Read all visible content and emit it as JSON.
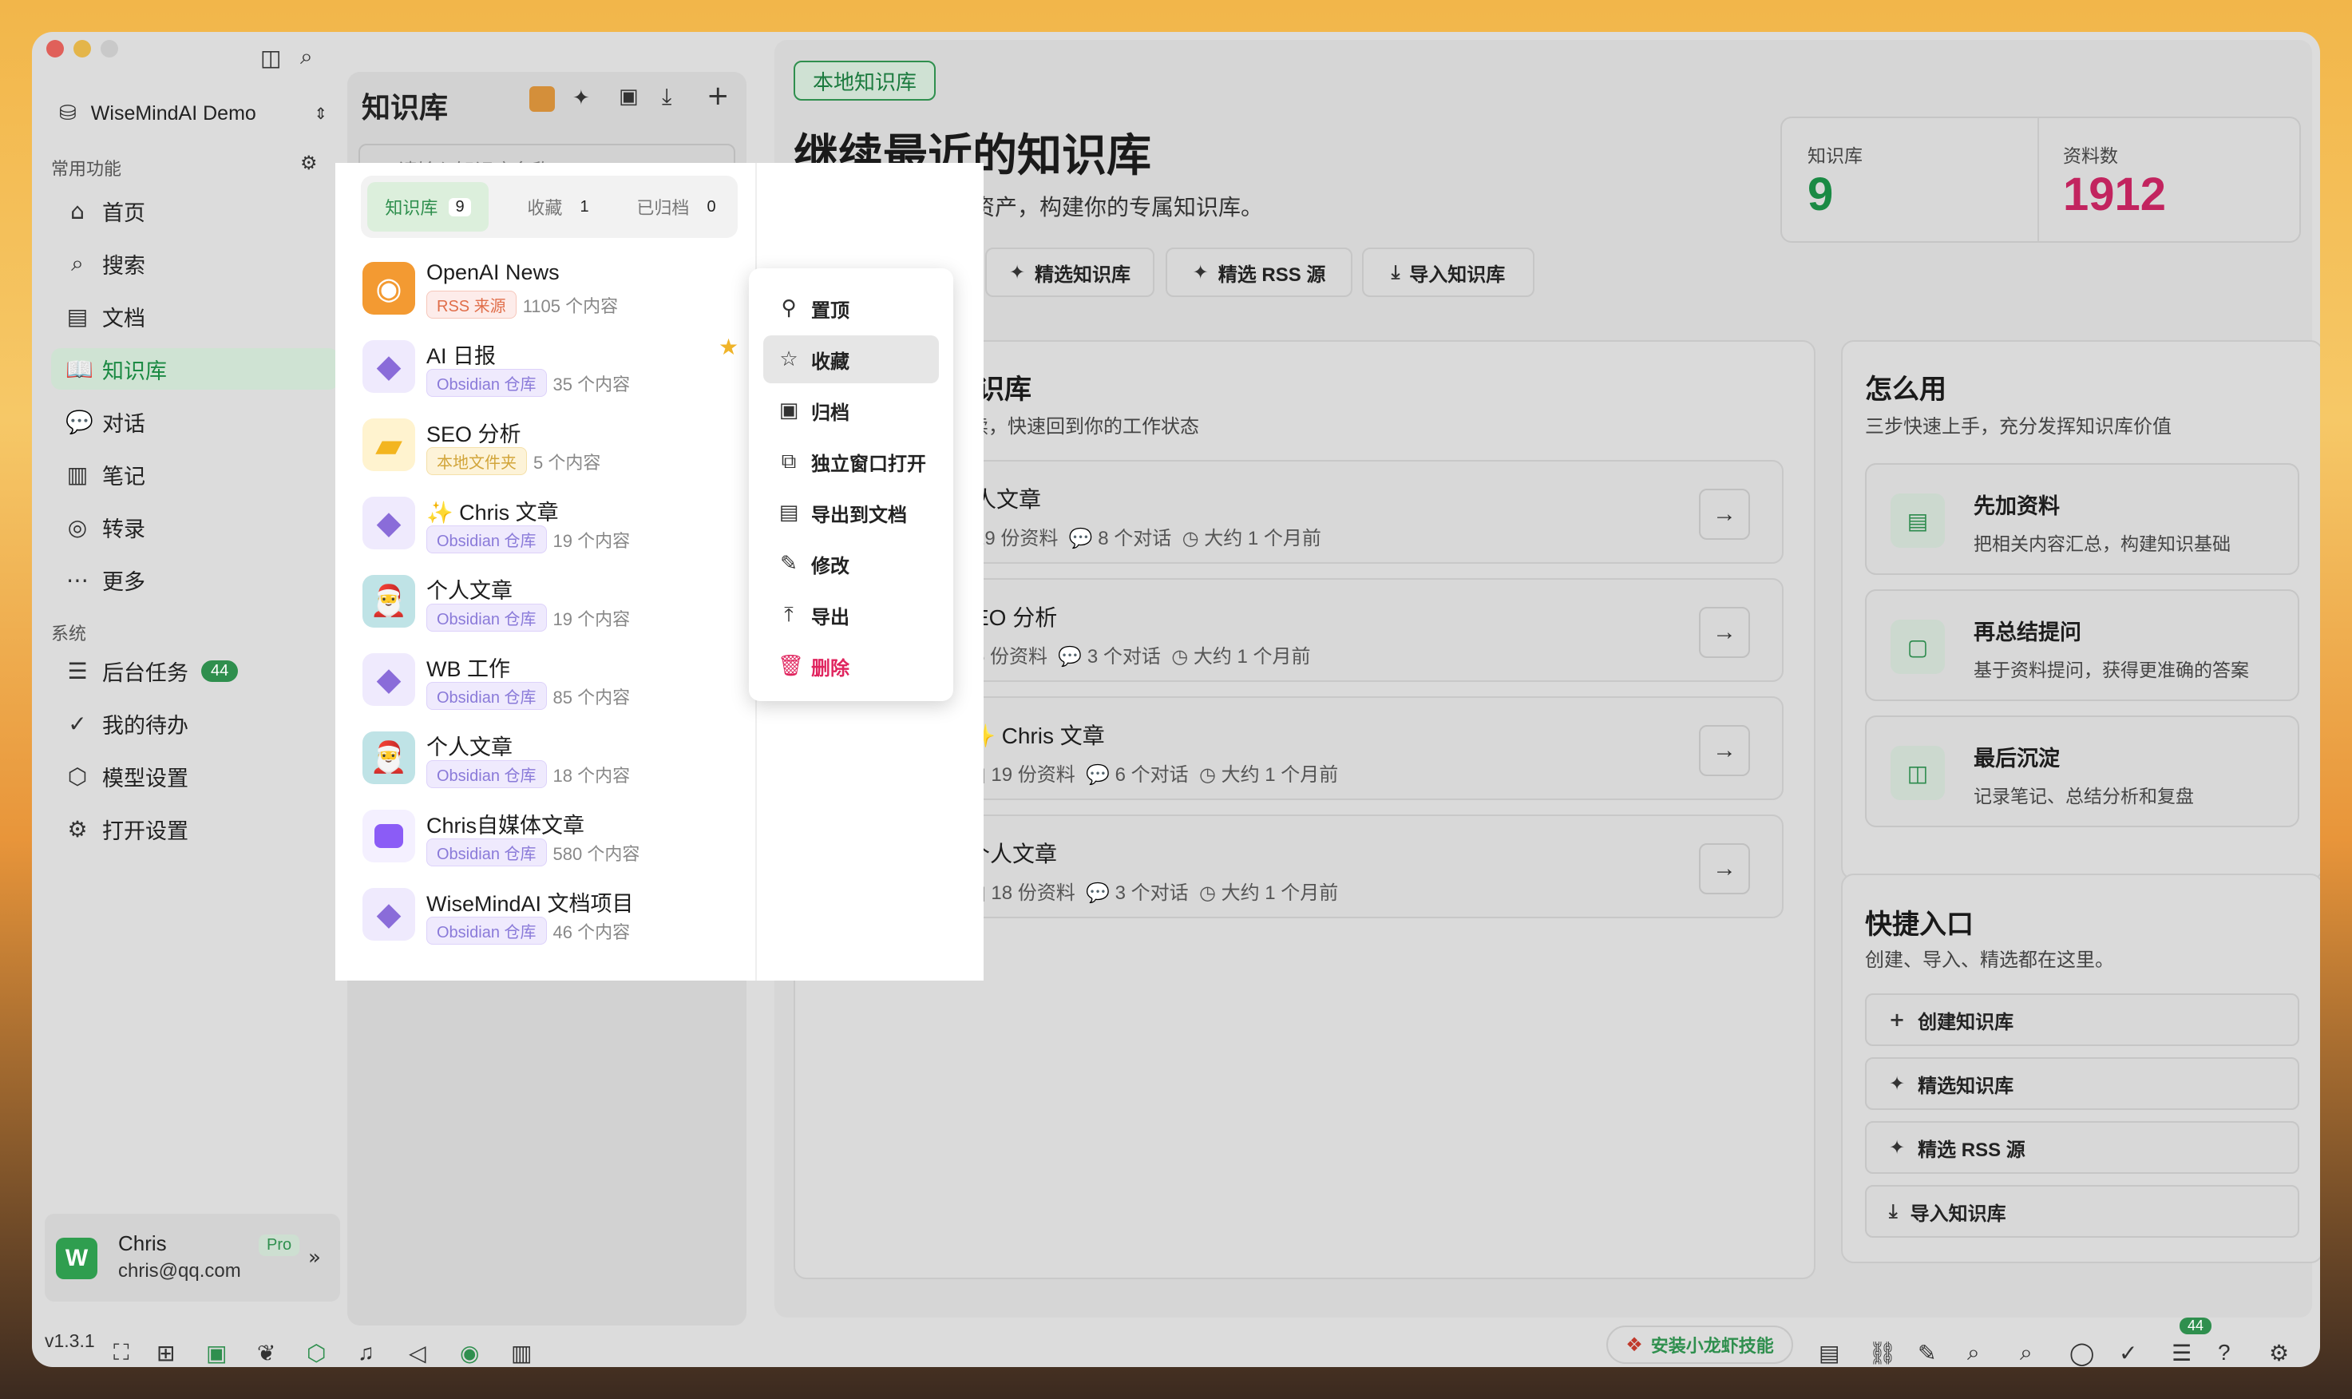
{
  "sidebar": {
    "workspace": "WiseMindAI Demo",
    "common_label": "常用功能",
    "system_label": "系统",
    "items": [
      {
        "label": "首页",
        "icon": "home-icon"
      },
      {
        "label": "搜索",
        "icon": "search-icon"
      },
      {
        "label": "文档",
        "icon": "document-icon"
      },
      {
        "label": "知识库",
        "icon": "book-icon"
      },
      {
        "label": "对话",
        "icon": "chat-icon"
      },
      {
        "label": "笔记",
        "icon": "notebook-icon"
      },
      {
        "label": "转录",
        "icon": "transcribe-icon"
      },
      {
        "label": "更多",
        "icon": "more-icon"
      }
    ],
    "system_items": [
      {
        "label": "后台任务",
        "badge": "44"
      },
      {
        "label": "我的待办"
      },
      {
        "label": "模型设置"
      },
      {
        "label": "打开设置"
      }
    ],
    "user": {
      "name": "Chris",
      "email": "chris@qq.com",
      "plan": "Pro"
    }
  },
  "kb_panel": {
    "title": "知识库",
    "search_placeholder": "请输入知识库名称",
    "tabs": [
      {
        "label": "知识库",
        "count": "9"
      },
      {
        "label": "收藏",
        "count": "1"
      },
      {
        "label": "已归档",
        "count": "0"
      }
    ],
    "items": [
      {
        "name": "OpenAI News",
        "tag": "RSS 来源",
        "tag_type": "rss",
        "count": "1105 个内容"
      },
      {
        "name": "AI 日报",
        "tag": "Obsidian 仓库",
        "tag_type": "obs",
        "count": "35 个内容",
        "starred": true
      },
      {
        "name": "SEO 分析",
        "tag": "本地文件夹",
        "tag_type": "local",
        "count": "5 个内容"
      },
      {
        "name": "✨ Chris 文章",
        "tag": "Obsidian 仓库",
        "tag_type": "obs",
        "count": "19 个内容"
      },
      {
        "name": "个人文章",
        "tag": "Obsidian 仓库",
        "tag_type": "obs",
        "count": "19 个内容"
      },
      {
        "name": "WB 工作",
        "tag": "Obsidian 仓库",
        "tag_type": "obs",
        "count": "85 个内容"
      },
      {
        "name": "个人文章",
        "tag": "Obsidian 仓库",
        "tag_type": "obs",
        "count": "18 个内容"
      },
      {
        "name": "Chris自媒体文章",
        "tag": "Obsidian 仓库",
        "tag_type": "obs",
        "count": "580 个内容"
      },
      {
        "name": "WiseMindAI 文档项目",
        "tag": "Obsidian 仓库",
        "tag_type": "obs",
        "count": "46 个内容"
      }
    ]
  },
  "context_menu": {
    "items": [
      {
        "label": "置顶",
        "icon": "pin-icon"
      },
      {
        "label": "收藏",
        "icon": "star-icon"
      },
      {
        "label": "归档",
        "icon": "archive-icon"
      },
      {
        "label": "独立窗口打开",
        "icon": "open-window-icon"
      },
      {
        "label": "导出到文档",
        "icon": "export-doc-icon"
      },
      {
        "label": "修改",
        "icon": "edit-icon"
      },
      {
        "label": "导出",
        "icon": "upload-icon"
      },
      {
        "label": "删除",
        "icon": "trash-icon"
      }
    ]
  },
  "main": {
    "badge": "本地知识库",
    "heading": "继续最近的知识库",
    "subheading": "集中管理你的知识资产，构建你的专属知识库。",
    "stats": [
      {
        "label": "知识库",
        "value": "9",
        "color": "#1a8a44"
      },
      {
        "label": "资料数",
        "value": "1912",
        "color": "#c2245f"
      }
    ],
    "actions": [
      "精选知识库",
      "精选 RSS 源",
      "导入知识库"
    ],
    "recent_title": "知识库",
    "recent_sub": "继续，快速回到你的工作状态",
    "recent": [
      {
        "title": "人文章",
        "docs": "19 份资料",
        "chats": "8 个对话",
        "time": "大约 1 个月前"
      },
      {
        "title": "EO 分析",
        "docs": "5 份资料",
        "chats": "3 个对话",
        "time": "大约 1 个月前"
      },
      {
        "title": "✨ Chris 文章",
        "docs": "19 份资料",
        "chats": "6 个对话",
        "time": "大约 1 个月前"
      },
      {
        "title": "个人文章",
        "docs": "18 份资料",
        "chats": "3 个对话",
        "time": "大约 1 个月前"
      }
    ],
    "howto": {
      "title": "怎么用",
      "sub": "三步快速上手，充分发挥知识库价值",
      "steps": [
        {
          "t": "先加资料",
          "d": "把相关内容汇总，构建知识基础"
        },
        {
          "t": "再总结提问",
          "d": "基于资料提问，获得更准确的答案"
        },
        {
          "t": "最后沉淀",
          "d": "记录笔记、总结分析和复盘"
        }
      ]
    },
    "quick": {
      "title": "快捷入口",
      "sub": "创建、导入、精选都在这里。",
      "items": [
        "创建知识库",
        "精选知识库",
        "精选 RSS 源",
        "导入知识库"
      ]
    }
  },
  "statusbar": {
    "version": "v1.3.1",
    "install_label": "安装小龙虾技能",
    "badge": "44"
  }
}
